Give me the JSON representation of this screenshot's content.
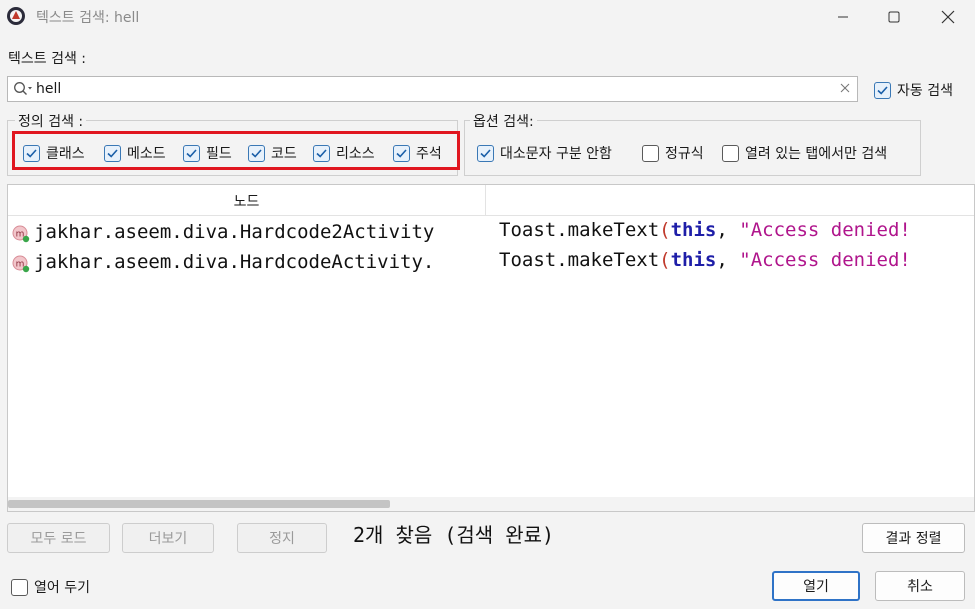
{
  "window": {
    "title": "텍스트 검색: hell",
    "controls": {
      "minimize": "minimize",
      "maximize": "maximize",
      "close": "close"
    }
  },
  "search": {
    "label": "텍스트 검색 :",
    "value": "hell",
    "auto_search_label": "자동 검색",
    "auto_search_checked": true
  },
  "definition_search": {
    "title": "정의 검색 :",
    "options": [
      {
        "label": "클래스",
        "checked": true
      },
      {
        "label": "메소드",
        "checked": true
      },
      {
        "label": "필드",
        "checked": true
      },
      {
        "label": "코드",
        "checked": true
      },
      {
        "label": "리소스",
        "checked": true
      },
      {
        "label": "주석",
        "checked": true
      }
    ]
  },
  "option_search": {
    "title": "옵션 검색:",
    "options": [
      {
        "label": "대소문자 구분 안함",
        "checked": true
      },
      {
        "label": "정규식",
        "checked": false
      },
      {
        "label": "열려 있는 탭에서만 검색",
        "checked": false
      }
    ]
  },
  "results": {
    "column_node": "노드",
    "rows": [
      {
        "node": "jakhar.aseem.diva.Hardcode2Activity",
        "code_prefix": "Toast.makeText",
        "code_paren": "(",
        "code_kw": "this",
        "code_comma": ", ",
        "code_str": "\"Access denied!"
      },
      {
        "node": "jakhar.aseem.diva.HardcodeActivity.",
        "code_prefix": "Toast.makeText",
        "code_paren": "(",
        "code_kw": "this",
        "code_comma": ", ",
        "code_str": "\"Access denied!"
      }
    ]
  },
  "actions": {
    "load_all": "모두 로드",
    "more": "더보기",
    "stop": "정지",
    "status": "2개 찾음 (검색 완료)",
    "sort_results": "결과 정렬",
    "keep_open": "열어 두기",
    "open": "열기",
    "cancel": "취소"
  },
  "colors": {
    "highlight_border": "#e0161f",
    "keyword": "#1e1ea8",
    "string": "#b0158c",
    "primary_button_border": "#2f73c7"
  }
}
